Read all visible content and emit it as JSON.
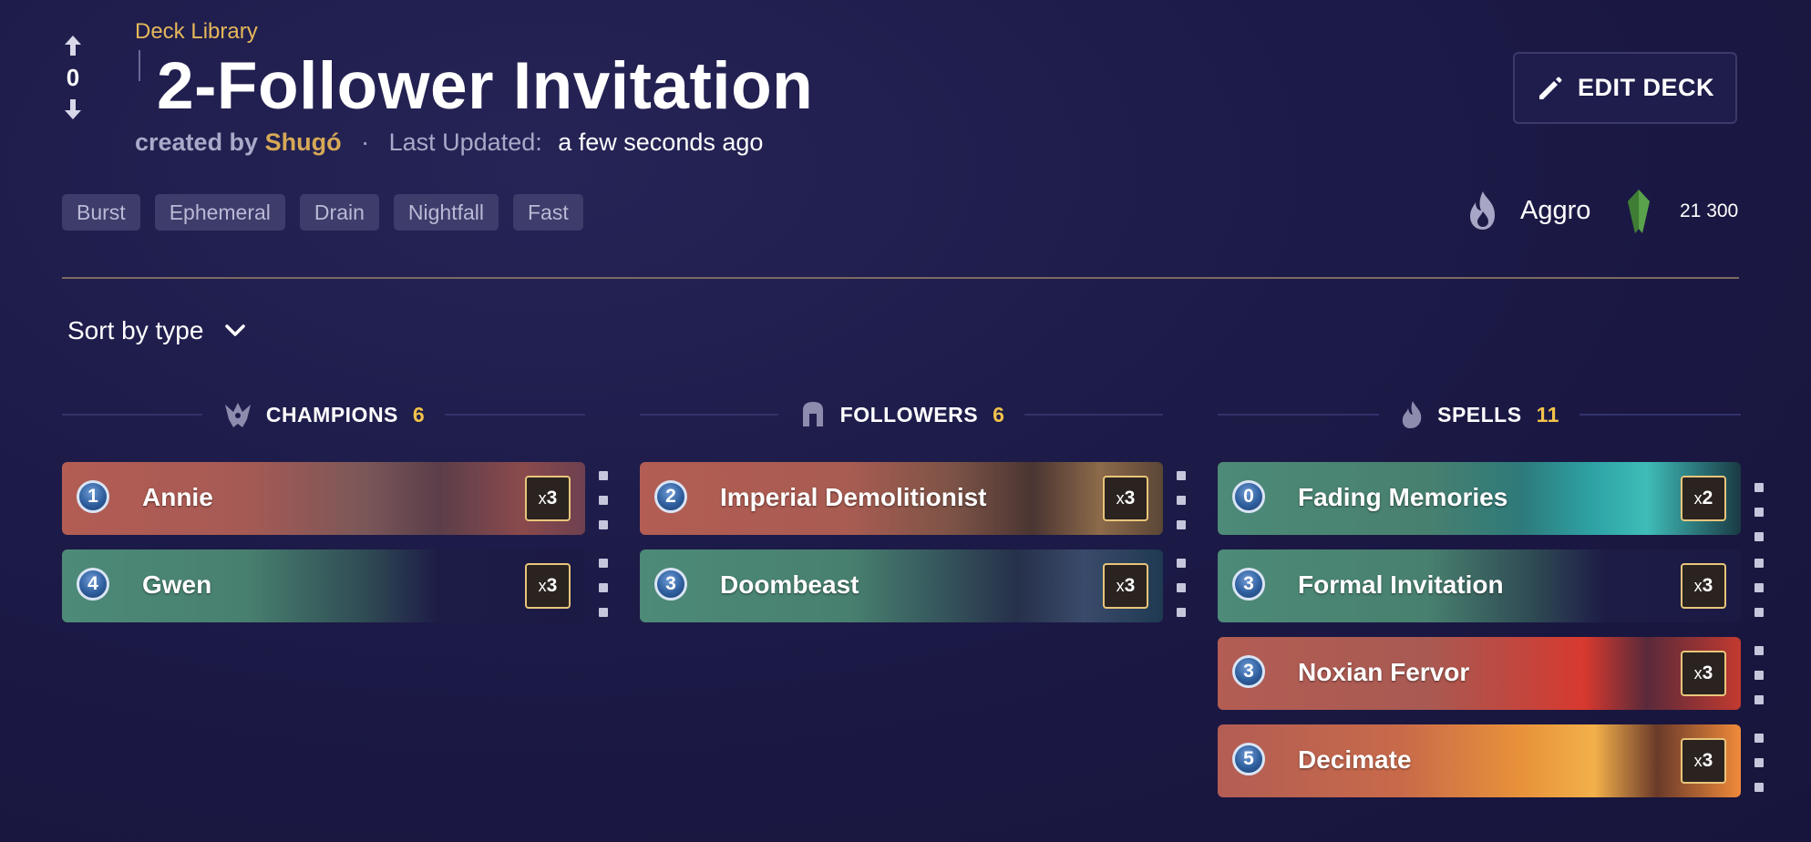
{
  "vote": {
    "count": "0"
  },
  "header": {
    "breadcrumb": "Deck Library",
    "title": "2-Follower Invitation",
    "created_by_label": "created by",
    "author": "Shugó",
    "updated_label": "Last Updated:",
    "updated_value": "a few seconds ago",
    "edit_button": "EDIT DECK"
  },
  "keywords": [
    "Burst",
    "Ephemeral",
    "Drain",
    "Nightfall",
    "Fast"
  ],
  "archetype": {
    "label": "Aggro",
    "icon": "flame-icon"
  },
  "cost": {
    "value": "21 300",
    "icon": "shard-icon"
  },
  "sort": {
    "label": "Sort by type"
  },
  "columns": {
    "champions": {
      "label": "CHAMPIONS",
      "count": "6"
    },
    "followers": {
      "label": "FOLLOWERS",
      "count": "6"
    },
    "spells": {
      "label": "SPELLS",
      "count": "11"
    }
  },
  "cards": {
    "champions": [
      {
        "cost": "1",
        "name": "Annie",
        "qty_x": "x",
        "qty": "3"
      },
      {
        "cost": "4",
        "name": "Gwen",
        "qty_x": "x",
        "qty": "3"
      }
    ],
    "followers": [
      {
        "cost": "2",
        "name": "Imperial Demolitionist",
        "qty_x": "x",
        "qty": "3"
      },
      {
        "cost": "3",
        "name": "Doombeast",
        "qty_x": "x",
        "qty": "3"
      }
    ],
    "spells": [
      {
        "cost": "0",
        "name": "Fading Memories",
        "qty_x": "x",
        "qty": "2"
      },
      {
        "cost": "3",
        "name": "Formal Invitation",
        "qty_x": "x",
        "qty": "3"
      },
      {
        "cost": "3",
        "name": "Noxian Fervor",
        "qty_x": "x",
        "qty": "3"
      },
      {
        "cost": "5",
        "name": "Decimate",
        "qty_x": "x",
        "qty": "3"
      }
    ]
  },
  "colors": {
    "accent_gold": "#e6b85a",
    "background": "#1c1a47",
    "region_noxus": "#b85a52",
    "region_shadow_isles": "#4d8a78",
    "count_yellow": "#f2c24b"
  }
}
